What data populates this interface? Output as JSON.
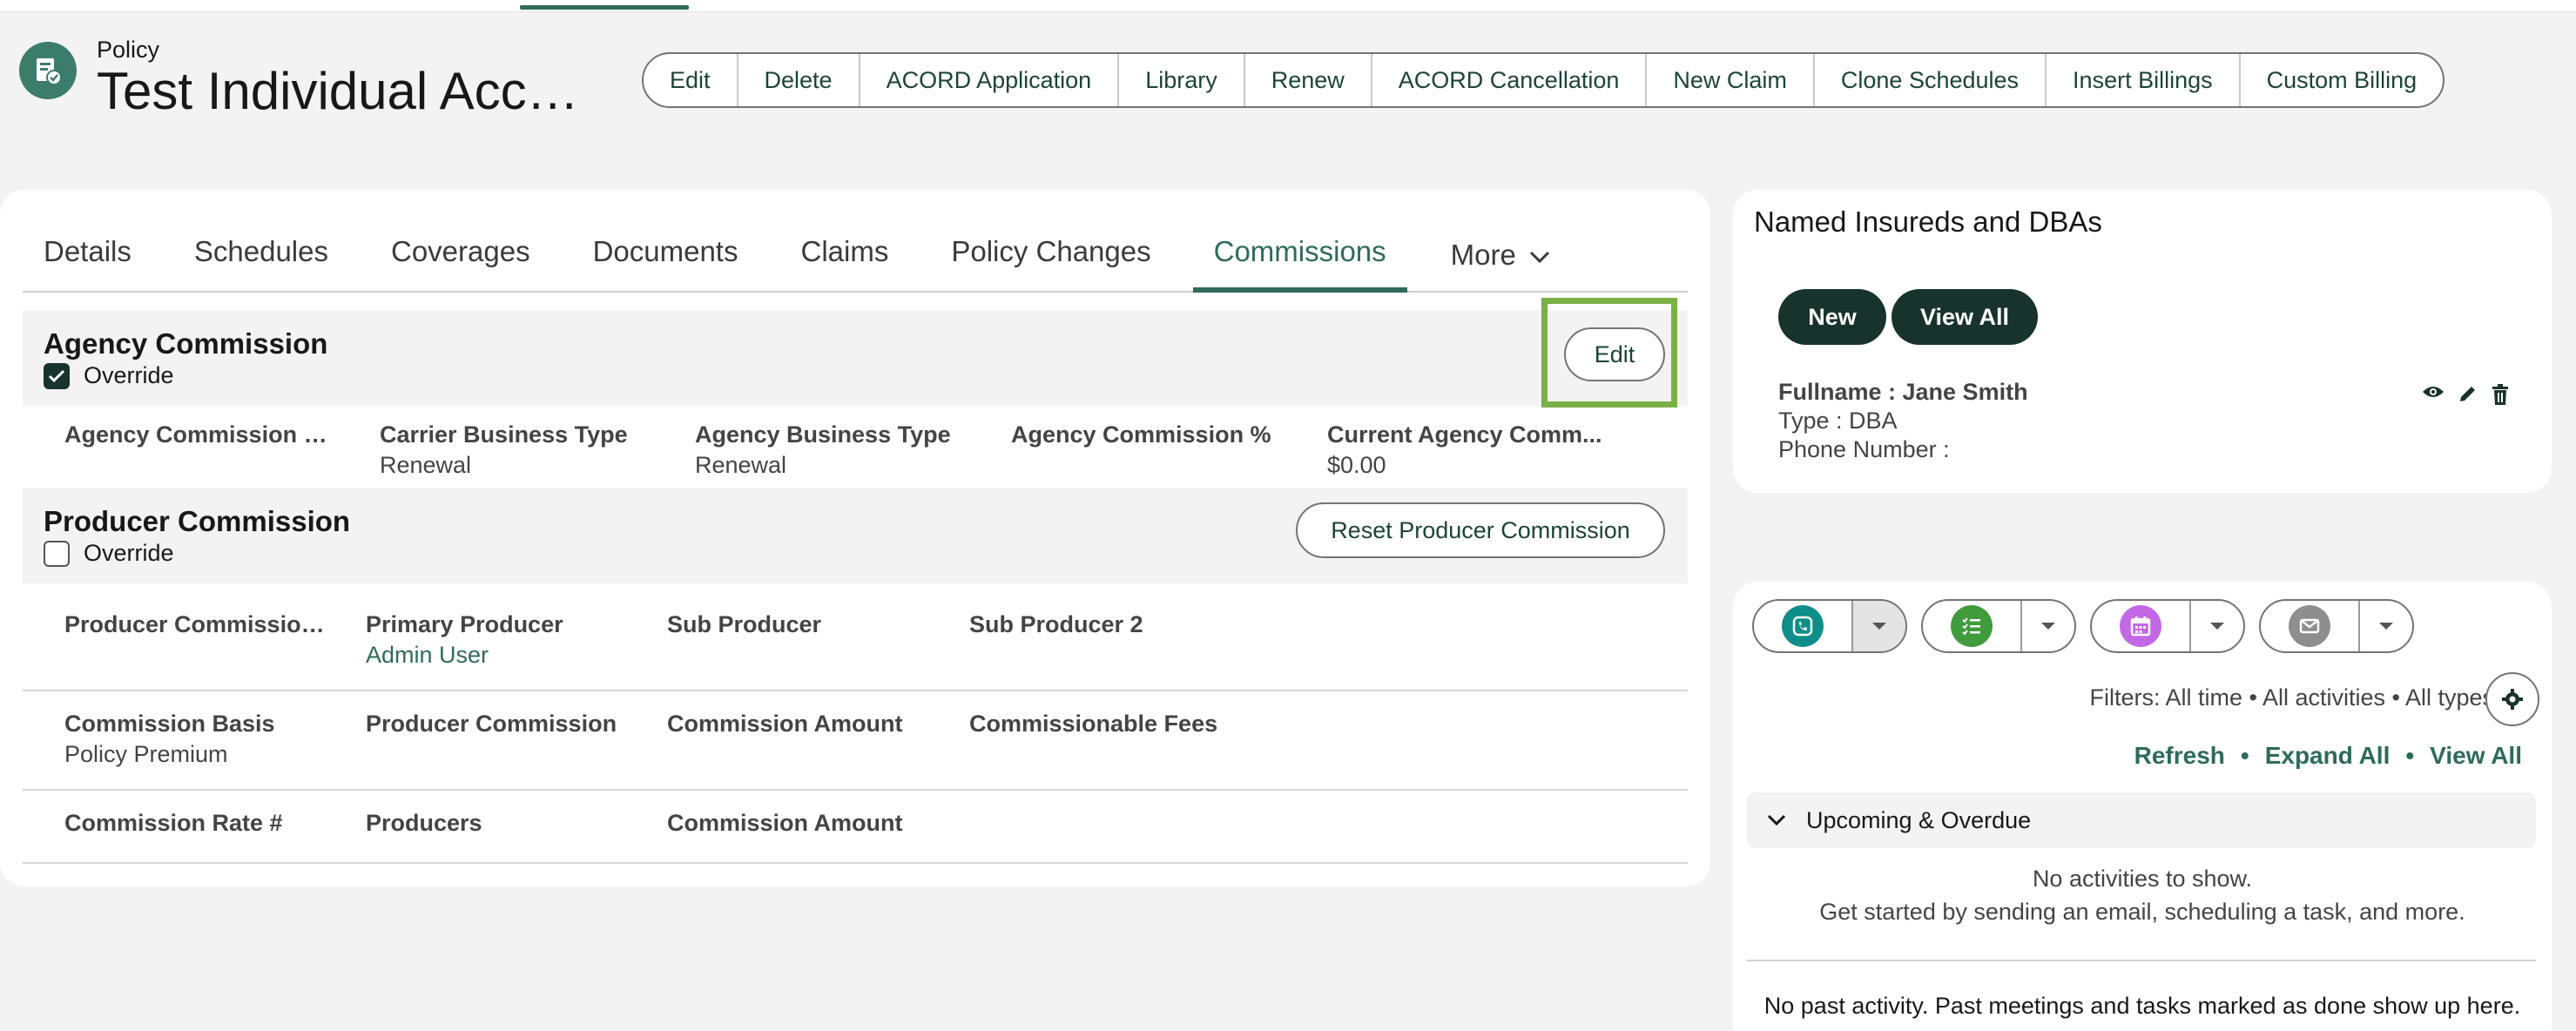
{
  "header": {
    "object_type": "Policy",
    "title": "Test Individual Accoun...",
    "actions": [
      "Edit",
      "Delete",
      "ACORD Application",
      "Library",
      "Renew",
      "ACORD Cancellation",
      "New Claim",
      "Clone Schedules",
      "Insert Billings",
      "Custom Billing"
    ]
  },
  "tabs": {
    "items": [
      "Details",
      "Schedules",
      "Coverages",
      "Documents",
      "Claims",
      "Policy Changes",
      "Commissions"
    ],
    "active": "Commissions",
    "more_label": "More"
  },
  "agency": {
    "title": "Agency Commission",
    "override_label": "Override",
    "override_checked": true,
    "edit_label": "Edit",
    "fields": [
      {
        "label": "Agency Commission R...",
        "value": ""
      },
      {
        "label": "Carrier Business Type",
        "value": "Renewal"
      },
      {
        "label": "Agency Business Type",
        "value": "Renewal"
      },
      {
        "label": "Agency Commission %",
        "value": ""
      },
      {
        "label": "Current Agency Comm...",
        "value": "$0.00"
      }
    ]
  },
  "producer": {
    "title": "Producer Commission",
    "override_label": "Override",
    "override_checked": false,
    "reset_label": "Reset Producer Commission",
    "row1": [
      {
        "label": "Producer Commission ...",
        "value": ""
      },
      {
        "label": "Primary Producer",
        "value": "Admin User"
      },
      {
        "label": "Sub Producer",
        "value": ""
      },
      {
        "label": "Sub Producer 2",
        "value": ""
      }
    ],
    "row2": [
      {
        "label": "Commission Basis",
        "value": "Policy Premium"
      },
      {
        "label": "Producer Commission",
        "value": ""
      },
      {
        "label": "Commission Amount",
        "value": ""
      },
      {
        "label": "Commissionable Fees",
        "value": ""
      }
    ],
    "row3": [
      {
        "label": "Commission Rate #",
        "value": ""
      },
      {
        "label": "Producers",
        "value": ""
      },
      {
        "label": "Commission Amount",
        "value": ""
      }
    ]
  },
  "insureds": {
    "title": "Named Insureds and DBAs",
    "new_label": "New",
    "view_all_label": "View All",
    "record": {
      "name": "Fullname : Jane Smith",
      "type": "Type : DBA",
      "phone": "Phone Number :"
    }
  },
  "activity": {
    "filters": "Filters: All time • All activities • All types",
    "links": [
      "Refresh",
      "Expand All",
      "View All"
    ],
    "upcoming_label": "Upcoming & Overdue",
    "empty_title": "No activities to show.",
    "empty_sub": "Get started by sending an email, scheduling a task, and more.",
    "past_empty": "No past activity. Past meetings and tasks marked as done show up here.",
    "icon_colors": {
      "call": "#0f8e89",
      "task": "#3f9b3c",
      "event": "#c368e4",
      "email": "#8e8e8e"
    }
  },
  "colors": {
    "brand": "#2e6b5a",
    "dark_button": "#18332b",
    "highlight": "#7ab046"
  }
}
